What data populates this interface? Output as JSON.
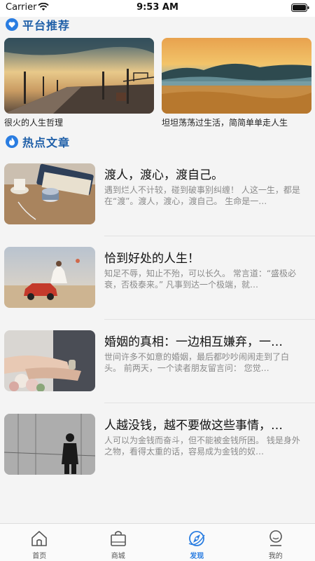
{
  "status_bar": {
    "carrier": "Carrier",
    "time": "9:53 AM"
  },
  "recommend": {
    "title": "平台推荐",
    "items": [
      {
        "caption": "很火的人生哲理"
      },
      {
        "caption": "坦坦荡荡过生活，简简单单走人生"
      }
    ]
  },
  "hot": {
    "title": "热点文章",
    "articles": [
      {
        "title": "渡人，渡心，渡自己。",
        "summary": "遇到烂人不计较，碰到破事别纠缠！ 人这一生，都是在“渡”。渡人，渡心，渡自己。 生命是一…"
      },
      {
        "title": "恰到好处的人生！",
        "summary": "知足不辱，知止不殆，可以长久。 常言道：“盛极必衰，否极泰来。” 凡事到达一个极端，就…"
      },
      {
        "title": "婚姻的真相：一边相互嫌弃，一…",
        "summary": "世间许多不如意的婚姻，最后都吵吵闹闹走到了白头。 前两天，一个读者朋友留言问： 您觉…"
      },
      {
        "title": "人越没钱，越不要做这些事情，…",
        "summary": "人可以为金钱而奋斗，但不能被金钱所困。 钱是身外之物，看得太重的话，容易成为金钱的奴…"
      }
    ]
  },
  "tabs": [
    {
      "label": "首页",
      "icon": "home-icon"
    },
    {
      "label": "商城",
      "icon": "shopping-bag-icon"
    },
    {
      "label": "发现",
      "icon": "discover-icon"
    },
    {
      "label": "我的",
      "icon": "profile-icon"
    }
  ],
  "active_tab": "发现",
  "colors": {
    "accent": "#2a7de1",
    "section_title": "#1f5fa8"
  }
}
